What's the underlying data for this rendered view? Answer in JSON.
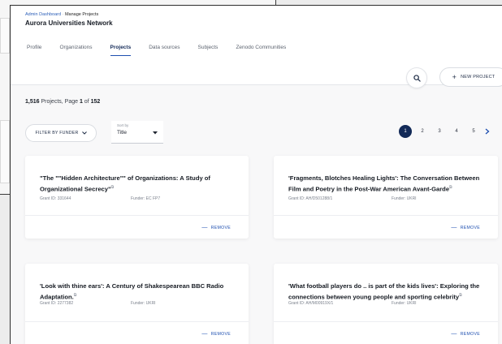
{
  "breadcrumb": {
    "root": "Admin Dashboard",
    "separator": "·",
    "current": "Manage Projects"
  },
  "page_title": "Aurora Universities Network",
  "tabs": [
    {
      "label": "Profile",
      "active": false
    },
    {
      "label": "Organizations",
      "active": false
    },
    {
      "label": "Projects",
      "active": true
    },
    {
      "label": "Data sources",
      "active": false
    },
    {
      "label": "Subjects",
      "active": false
    },
    {
      "label": "Zenodo Communities",
      "active": false
    }
  ],
  "actions": {
    "new_project": "NEW PROJECT",
    "new_project_icon": "plus-icon",
    "search_icon": "search-icon"
  },
  "summary": {
    "count": "1,516",
    "text1": " Projects, Page ",
    "page": "1",
    "text2": " of ",
    "pages": "152"
  },
  "filter": {
    "label": "FILTER BY FUNDER",
    "icon": "chevron-down-icon"
  },
  "sort": {
    "label": "Sort by",
    "value": "Title"
  },
  "pagination": {
    "pages": [
      "1",
      "2",
      "3",
      "4",
      "5"
    ],
    "active": "1",
    "next_icon": "chevron-right-icon"
  },
  "projects": [
    {
      "title": "\"The \"\"Hidden Architecture\"\" of Organizations: A Study of Organizational Secrecy\"",
      "grant_label": "Grant ID:",
      "grant": "331644",
      "funder_label": "Funder:",
      "funder": "EC FP7",
      "remove": "REMOVE"
    },
    {
      "title": "'Fragments, Blotches Healing Lights': The Conversation Between Film and Poetry in the Post-War American Avant-Garde",
      "grant_label": "Grant ID:",
      "grant": "AH/D501288/1",
      "funder_label": "Funder:",
      "funder": "UKRI",
      "remove": "REMOVE"
    },
    {
      "title": "'Look with thine ears': A Century of Shakespearean BBC Radio Adaptation.",
      "grant_label": "Grant ID:",
      "grant": "2277382",
      "funder_label": "Funder:",
      "funder": "UKRI",
      "remove": "REMOVE"
    },
    {
      "title": "'What football players do .. is part of the kids lives': Exploring the connections between young people and sporting celebrity",
      "grant_label": "Grant ID:",
      "grant": "AH/M00919X/1",
      "funder_label": "Funder:",
      "funder": "UKRI",
      "remove": "REMOVE"
    }
  ],
  "colors": {
    "accent": "#1e4fb0",
    "primary_dark": "#132a58"
  }
}
